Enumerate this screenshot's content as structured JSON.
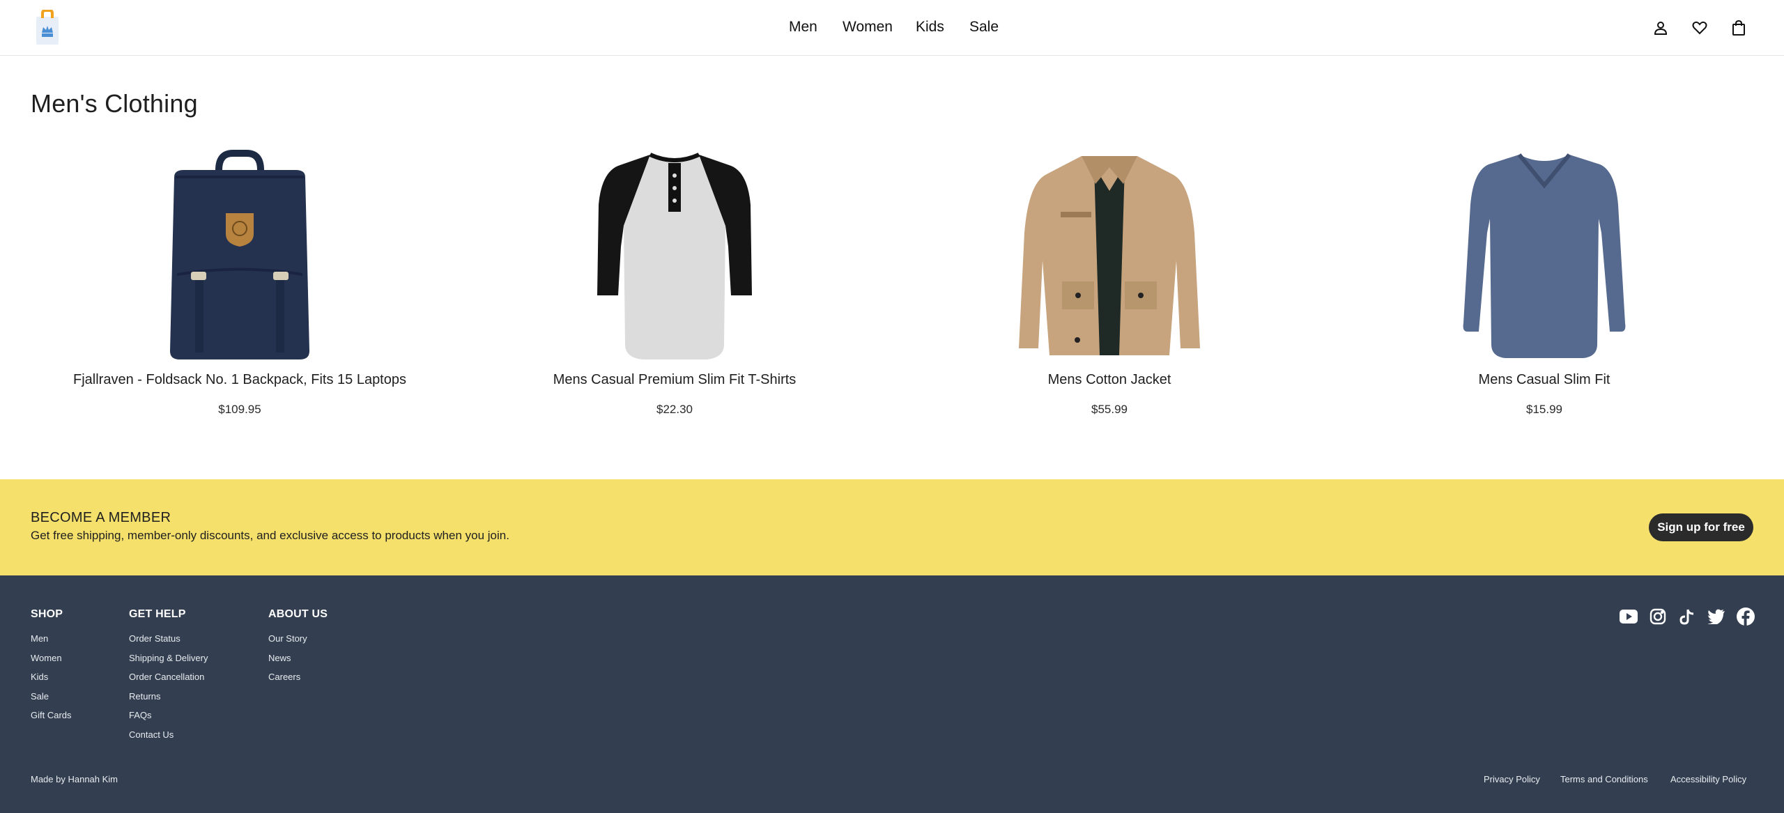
{
  "header": {
    "logo_icon": "shopping-bag-crown-logo",
    "nav": [
      {
        "label": "Men"
      },
      {
        "label": "Women"
      },
      {
        "label": "Kids"
      },
      {
        "label": "Sale"
      }
    ],
    "icons": [
      "user-icon",
      "heart-icon",
      "bag-icon"
    ]
  },
  "main": {
    "title": "Men's Clothing",
    "products": [
      {
        "name": "Fjallraven - Foldsack No. 1 Backpack, Fits 15 Laptops",
        "price": "$109.95",
        "image_icon": "backpack-image"
      },
      {
        "name": "Mens Casual Premium Slim Fit T-Shirts",
        "price": "$22.30",
        "image_icon": "raglan-tshirt-image"
      },
      {
        "name": "Mens Cotton Jacket",
        "price": "$55.99",
        "image_icon": "cotton-jacket-image"
      },
      {
        "name": "Mens Casual Slim Fit",
        "price": "$15.99",
        "image_icon": "longsleeve-shirt-image"
      }
    ]
  },
  "member": {
    "title": "BECOME A MEMBER",
    "description": "Get free shipping, member-only discounts, and exclusive access to products when you join.",
    "button": "Sign up for free",
    "background": "#f4e06b"
  },
  "footer": {
    "background": "#333f50",
    "columns": [
      {
        "heading": "SHOP",
        "links": [
          "Men",
          "Women",
          "Kids",
          "Sale",
          "Gift Cards"
        ]
      },
      {
        "heading": "GET HELP",
        "links": [
          "Order Status",
          "Shipping & Delivery",
          "Order Cancellation",
          "Returns",
          "FAQs",
          "Contact Us"
        ]
      },
      {
        "heading": "ABOUT US",
        "links": [
          "Our Story",
          "News",
          "Careers"
        ]
      }
    ],
    "social": [
      "youtube-icon",
      "instagram-icon",
      "tiktok-icon",
      "twitter-icon",
      "facebook-icon"
    ],
    "made_by": "Made by Hannah Kim",
    "legal": [
      "Privacy Policy",
      "Terms and Conditions",
      "Accessibility Policy"
    ]
  }
}
